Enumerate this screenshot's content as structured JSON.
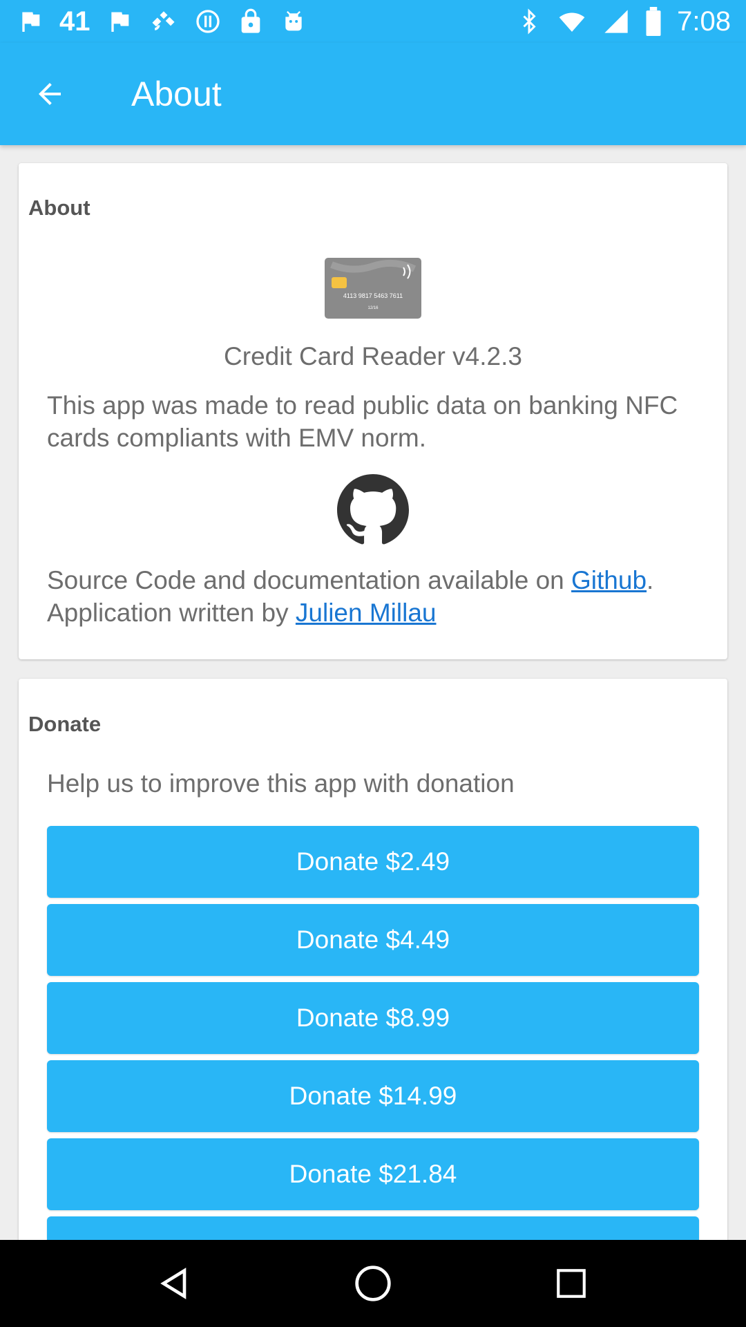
{
  "status_bar": {
    "left_icons": [
      "flag-icon",
      "notification-count",
      "flag-icon",
      "satellite-icon",
      "info-circle-icon",
      "lock-icon",
      "android-icon"
    ],
    "notification_count": "41",
    "right_icons": [
      "bluetooth-icon",
      "wifi-icon",
      "signal-icon",
      "battery-icon"
    ],
    "time": "7:08"
  },
  "app_bar": {
    "title": "About",
    "back_icon": "arrow-back-icon",
    "color": "#29b6f6"
  },
  "about_card": {
    "heading": "About",
    "card_image_text": "4113 9817 5463 7611",
    "card_image_expiry": "12/16",
    "version": "Credit Card Reader v4.2.3",
    "description": "This app was made to read public data on banking NFC cards compliants with EMV norm.",
    "github_icon": "github-icon",
    "source_prefix": "Source Code and documentation available on ",
    "source_link": "Github",
    "source_suffix": ".",
    "author_prefix": "Application written by ",
    "author_link": "Julien Millau"
  },
  "donate_card": {
    "heading": "Donate",
    "help_text": "Help us to improve this app with donation",
    "buttons": [
      "Donate $2.49",
      "Donate $4.49",
      "Donate $8.99",
      "Donate $14.99",
      "Donate $21.84"
    ]
  },
  "nav_bar": {
    "icons": [
      "back-triangle-icon",
      "home-circle-icon",
      "recents-square-icon"
    ]
  },
  "colors": {
    "accent": "#29b6f6",
    "link": "#1976d2",
    "text": "#6d6d6d",
    "heading": "#555555"
  }
}
